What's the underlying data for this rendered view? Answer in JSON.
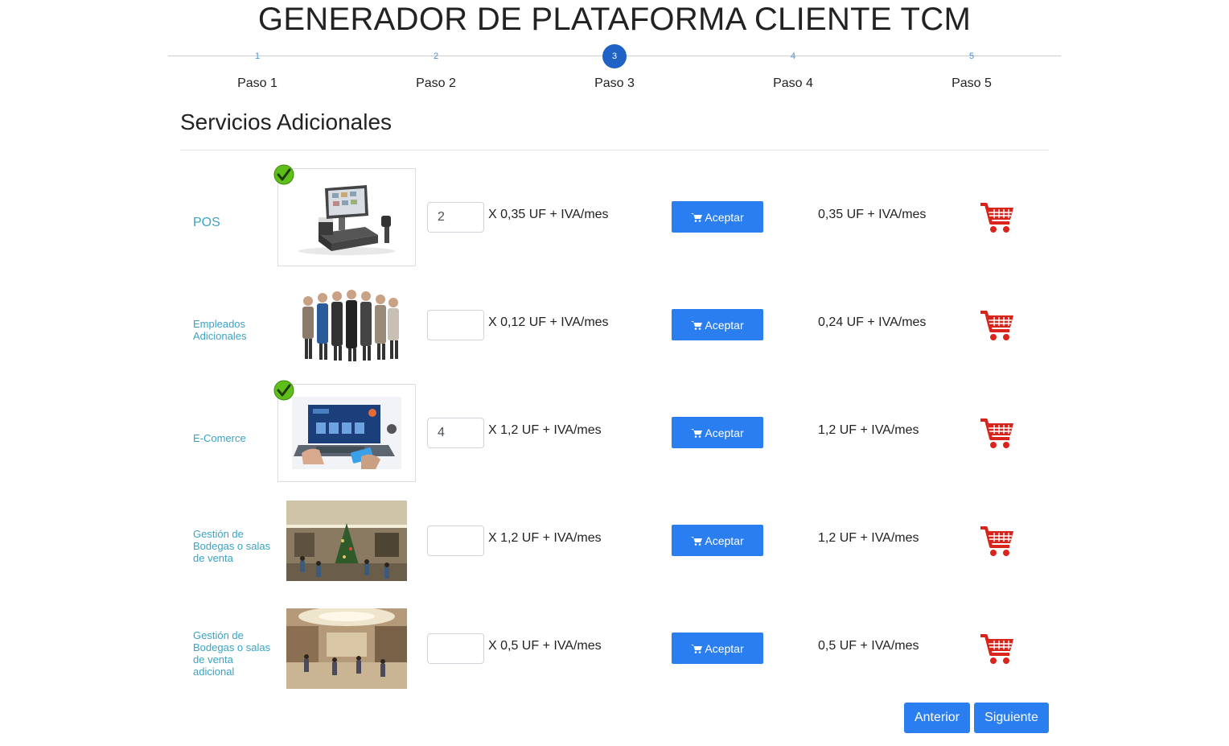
{
  "page_title": "GENERADOR DE PLATAFORMA CLIENTE TCM",
  "stepper": {
    "active_index": 2,
    "steps": [
      {
        "number": "1",
        "label": "Paso 1"
      },
      {
        "number": "2",
        "label": "Paso 2"
      },
      {
        "number": "3",
        "label": "Paso 3"
      },
      {
        "number": "4",
        "label": "Paso 4"
      },
      {
        "number": "5",
        "label": "Paso 5"
      }
    ]
  },
  "section_title": "Servicios Adicionales",
  "services": [
    {
      "name": "POS",
      "image": "pos-terminal-image",
      "selected": true,
      "quantity": "2",
      "unit_price": "X 0,35 UF + IVA/mes",
      "accept_label": "Aceptar",
      "total": "0,35 UF + IVA/mes"
    },
    {
      "name": "Empleados Adicionales",
      "image": "employees-group-image",
      "selected": false,
      "quantity": "",
      "unit_price": "X 0,12 UF + IVA/mes",
      "accept_label": "Aceptar",
      "total": "0,24 UF + IVA/mes"
    },
    {
      "name": "E-Comerce",
      "image": "ecommerce-laptop-image",
      "selected": true,
      "quantity": "4",
      "unit_price": "X 1,2 UF + IVA/mes",
      "accept_label": "Aceptar",
      "total": "1,2 UF + IVA/mes"
    },
    {
      "name": "Gestión de Bodegas o salas de venta",
      "image": "store-hall-image",
      "selected": false,
      "quantity": "",
      "unit_price": "X 1,2 UF + IVA/mes",
      "accept_label": "Aceptar",
      "total": "1,2 UF + IVA/mes"
    },
    {
      "name": "Gestión de Bodegas o salas de venta adicional",
      "image": "mall-image",
      "selected": false,
      "quantity": "",
      "unit_price": "X 0,5 UF + IVA/mes",
      "accept_label": "Aceptar",
      "total": "0,5 UF + IVA/mes"
    }
  ],
  "footer": {
    "previous_label": "Anterior",
    "next_label": "Siguiente"
  },
  "colors": {
    "primary": "#2a7ef0",
    "active_step": "#1f61c4",
    "link": "#3aa3c4",
    "cart": "#d9241b",
    "check": "#5fbf1a"
  },
  "icons": {
    "cart": "shopping-cart-icon",
    "button": "cart-icon",
    "selected": "check-icon"
  }
}
